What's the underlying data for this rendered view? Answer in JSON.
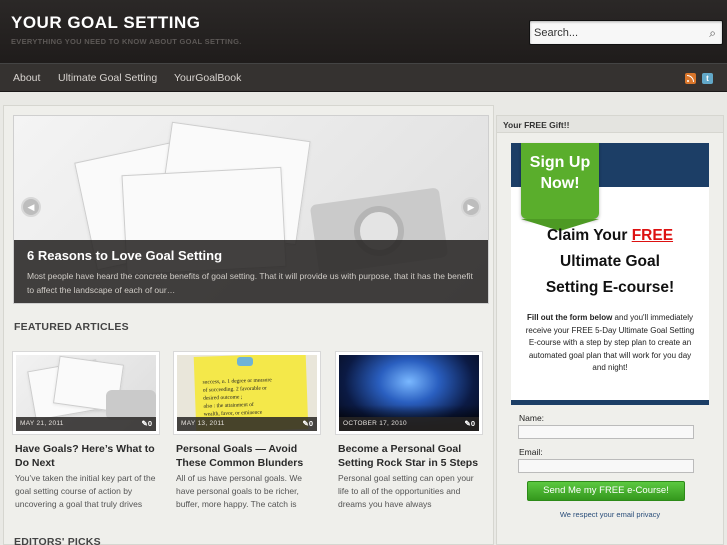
{
  "header": {
    "site_title": "YOUR GOAL SETTING",
    "site_description": "EVERYTHING YOU NEED TO KNOW ABOUT GOAL SETTING.",
    "search_placeholder": "Search..."
  },
  "nav": {
    "items": [
      {
        "label": "About"
      },
      {
        "label": "Ultimate Goal Setting"
      },
      {
        "label": "YourGoalBook"
      }
    ]
  },
  "slider": {
    "title": "6 Reasons to Love Goal Setting",
    "excerpt": "Most people have heard the concrete benefits of goal setting. That it will provide us with purpose, that it has the benefit to affect the landscape of each of our…",
    "prev_glyph": "◀",
    "next_glyph": "▶"
  },
  "featured": {
    "heading": "FEATURED ARTICLES",
    "articles": [
      {
        "date": "MAY 21, 2011",
        "comments": "0",
        "title": "Have Goals? Here’s What to Do Next",
        "excerpt": "You’ve taken the initial key part of the goal setting course of action by uncovering a goal that truly drives"
      },
      {
        "date": "MAY 13, 2011",
        "comments": "0",
        "title": "Personal Goals — Avoid These Common Blunders",
        "excerpt": "All of us have personal goals. We have personal goals to be richer, buffer, more happy. The catch is",
        "note_line1": "success, n. 1 degree or measure",
        "note_line2": "of succeeding. 2 favorable or",
        "note_line3": "desired outcome ;",
        "note_line4": "also : the attainment of",
        "note_line5": "wealth, favor, or eminence"
      },
      {
        "date": "OCTOBER 17, 2010",
        "comments": "0",
        "title": "Become a Personal Goal Setting Rock Star in 5 Steps",
        "excerpt": "Personal goal setting can open your life to all of the opportunities and dreams you have always"
      }
    ]
  },
  "editors_picks": {
    "heading": "EDITORS' PICKS"
  },
  "sidebar": {
    "widget_title": "Your FREE Gift!!",
    "badge_line1": "Sign Up",
    "badge_line2": "Now!",
    "claim_line1_prefix": "Claim Your",
    "claim_free": "FREE",
    "claim_line2": "Ultimate Goal",
    "claim_line3": "Setting E-course!",
    "optin_bold": "Fill out the form below",
    "optin_text": "and you'll immediately receive your FREE 5-Day Ultimate Goal Setting E-course with a step by step plan to create an automated goal plan that will work for you day and night!",
    "name_label": "Name:",
    "email_label": "Email:",
    "submit_label": "Send Me my FREE e-Course!",
    "privacy": "We respect your email privacy"
  },
  "colors": {
    "header_bg": "#262322",
    "nav_bg": "#353230",
    "optin_blue": "#1c3e66",
    "signup_green": "#5aae2c",
    "submit_green": "#45b12c",
    "free_red": "#dd1111"
  }
}
